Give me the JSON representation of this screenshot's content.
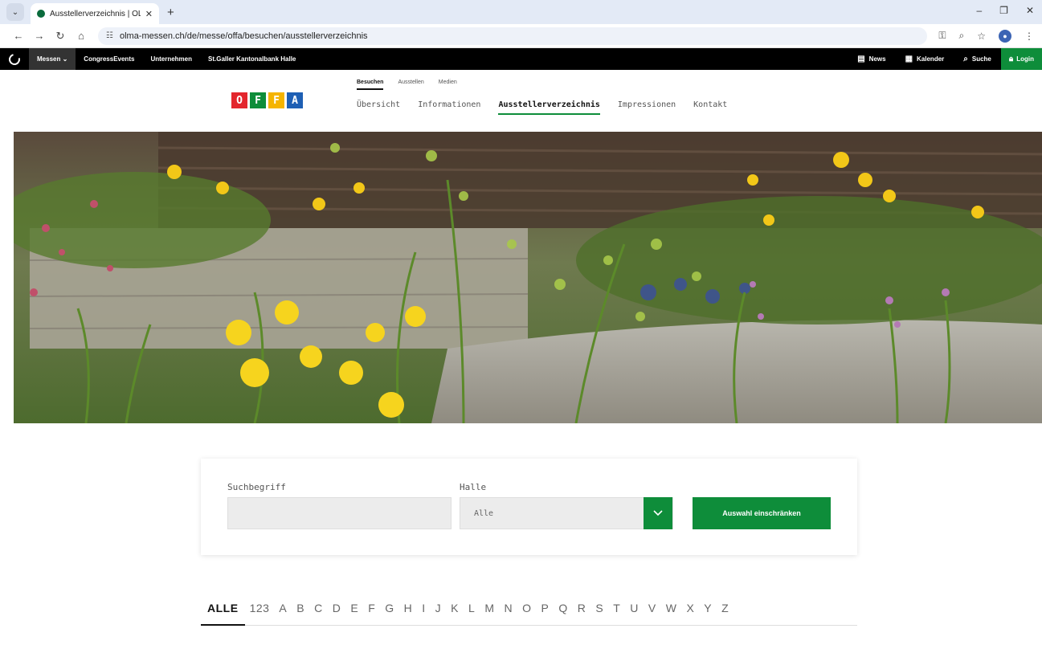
{
  "browser": {
    "tab_title": "Ausstellerverzeichnis | OLMA S",
    "url": "olma-messen.ch/de/messe/offa/besuchen/ausstellerverzeichnis"
  },
  "topnav": {
    "items": [
      "Messen",
      "CongressEvents",
      "Unternehmen",
      "St.Galler Kantonalbank Halle"
    ],
    "right": [
      "News",
      "Kalender",
      "Suche"
    ],
    "login": "Login"
  },
  "header": {
    "logo_letters": [
      "O",
      "F",
      "F",
      "A"
    ],
    "logo_colors": [
      "#e3262d",
      "#0e8d3a",
      "#f5b400",
      "#1e5fb4"
    ],
    "subtabs": [
      "Besuchen",
      "Ausstellen",
      "Medien"
    ],
    "mainnav": [
      "Übersicht",
      "Informationen",
      "Ausstellerverzeichnis",
      "Impressionen",
      "Kontakt"
    ]
  },
  "search": {
    "term_label": "Suchbegriff",
    "term_value": "",
    "hall_label": "Halle",
    "hall_value": "Alle",
    "submit_label": "Auswahl einschränken"
  },
  "alphabet": [
    "ALLE",
    "123",
    "A",
    "B",
    "C",
    "D",
    "E",
    "F",
    "G",
    "H",
    "I",
    "J",
    "K",
    "L",
    "M",
    "N",
    "O",
    "P",
    "Q",
    "R",
    "S",
    "T",
    "U",
    "V",
    "W",
    "X",
    "Y",
    "Z"
  ],
  "colors": {
    "brand_green": "#0e8d3a"
  }
}
